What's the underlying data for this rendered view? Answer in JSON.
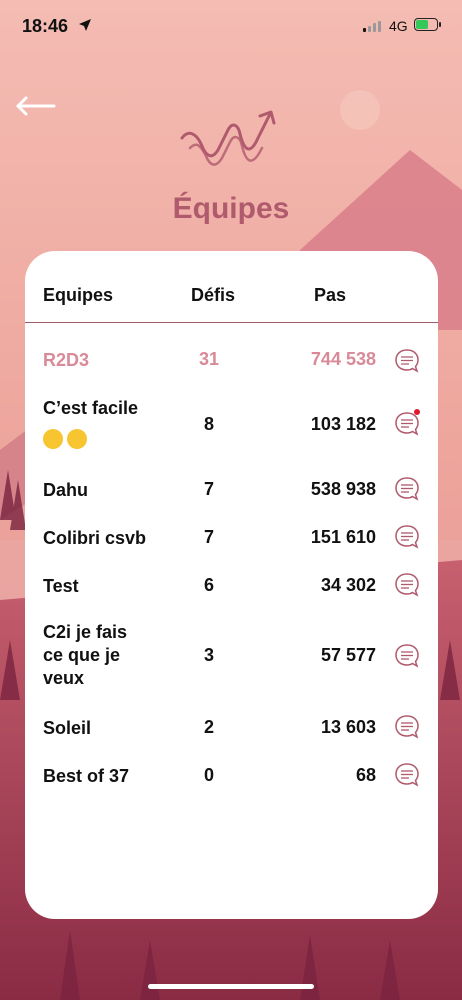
{
  "status_bar": {
    "time": "18:46",
    "network": "4G"
  },
  "header": {
    "title": "Équipes"
  },
  "table": {
    "columns": [
      "Equipes",
      "Défis",
      "Pas"
    ],
    "rows": [
      {
        "name_lines": [
          "R2D3"
        ],
        "defis": "31",
        "pas": "744 538",
        "highlight": true,
        "has_notification": false
      },
      {
        "name_lines": [
          "C’est facile"
        ],
        "emoji_line": true,
        "defis": "8",
        "pas": "103 182",
        "highlight": false,
        "has_notification": true
      },
      {
        "name_lines": [
          "Dahu"
        ],
        "defis": "7",
        "pas": "538 938",
        "highlight": false,
        "has_notification": false
      },
      {
        "name_lines": [
          "Colibri csvb"
        ],
        "defis": "7",
        "pas": "151 610",
        "highlight": false,
        "has_notification": false
      },
      {
        "name_lines": [
          "Test"
        ],
        "defis": "6",
        "pas": "34 302",
        "highlight": false,
        "has_notification": false
      },
      {
        "name_lines": [
          "C2i je fais",
          "ce que je",
          "veux"
        ],
        "defis": "3",
        "pas": "57 577",
        "highlight": false,
        "has_notification": false
      },
      {
        "name_lines": [
          "Soleil"
        ],
        "defis": "2",
        "pas": "13 603",
        "highlight": false,
        "has_notification": false
      },
      {
        "name_lines": [
          "Best of 37"
        ],
        "defis": "0",
        "pas": "68",
        "highlight": false,
        "has_notification": false
      }
    ]
  },
  "colors": {
    "accent": "#b05a6d",
    "highlight_row": "#d88a98",
    "notification_dot": "#e0182d"
  },
  "icons": {
    "back": "arrow-left-icon",
    "chat": "chat-bubble-icon",
    "location": "location-arrow-icon"
  }
}
